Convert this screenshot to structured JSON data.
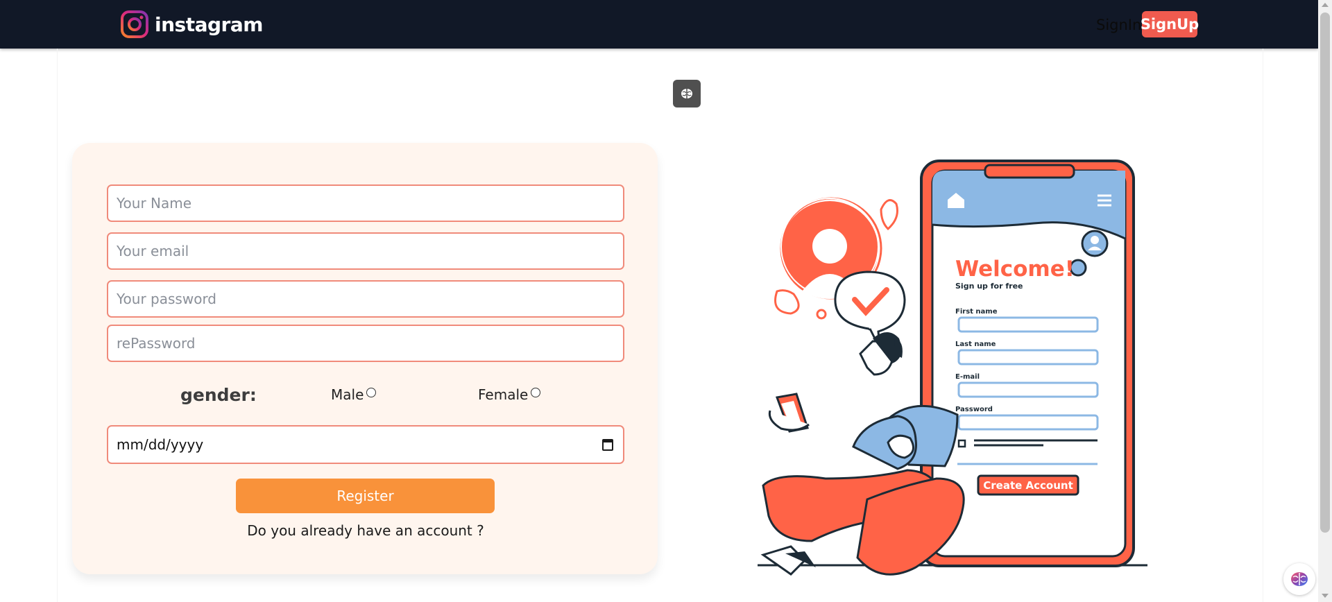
{
  "navbar": {
    "brand": "instagram",
    "signin_label": "SignIn",
    "signup_label": "SignUp"
  },
  "form": {
    "name_placeholder": "Your Name",
    "email_placeholder": "Your email",
    "password_placeholder": "Your password",
    "repassword_placeholder": "rePassword",
    "gender_label": "gender:",
    "gender_options": [
      "Male",
      "Female"
    ],
    "date_placeholder": "mm/dd/yyyy",
    "register_label": "Register",
    "account_link": "Do you already have an account ?"
  },
  "illustration": {
    "welcome_title": "Welcome!",
    "welcome_subtitle": "Sign up for free",
    "fields": [
      "First name",
      "Last name",
      "E-mail",
      "Password"
    ],
    "create_account_label": "Create Account"
  },
  "colors": {
    "navbar_bg": "#111827",
    "accent_red": "#f05b4f",
    "card_bg": "#fff5ee",
    "register_orange": "#f9923a",
    "illustration_red": "#ff6347",
    "illustration_blue": "#8cb8e4"
  }
}
